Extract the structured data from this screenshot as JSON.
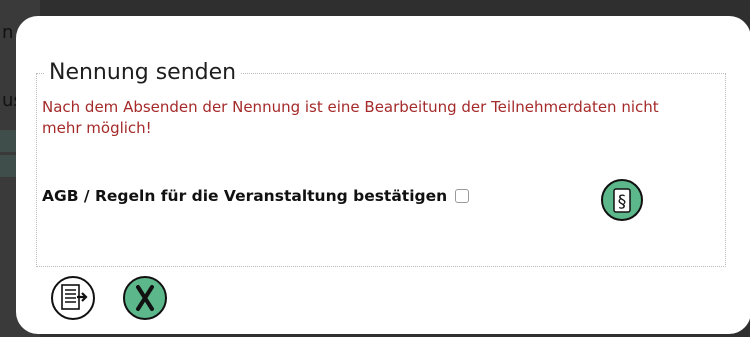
{
  "background": {
    "fragment_1": "n",
    "fragment_2": "us"
  },
  "dialog": {
    "title": "Nennung senden",
    "warning": "Nach dem Absenden der Nennung ist eine Bearbeitung der Teilnehmerdaten nicht mehr möglich!",
    "confirm_label": "AGB / Regeln für die Veranstaltung bestätigen",
    "confirm_checked": false,
    "rules_symbol": "§",
    "icons": {
      "rules": "paragraph-icon",
      "submit": "send-document-icon",
      "cancel": "close-x-icon"
    },
    "colors": {
      "accent_green": "#5cb88a",
      "warning_red": "#a52a2a"
    }
  }
}
